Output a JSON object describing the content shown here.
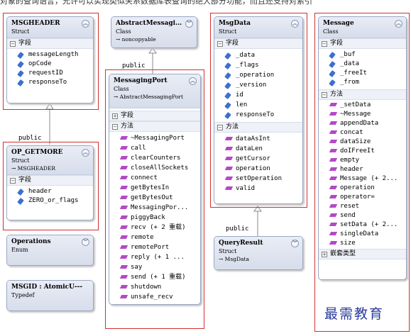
{
  "header_strip": "对象的查询语言，允许可以实现类似关系数据库表查询的绝大部分功能，而且还支持对索引",
  "relation_label": "public",
  "section_labels": {
    "fields": "字段",
    "methods": "方法",
    "nested_types": "嵌套类型"
  },
  "classes": {
    "msgheader": {
      "title": "MSGHEADER",
      "stereotype": "Struct",
      "fields": [
        "messageLength",
        "opCode",
        "requestID",
        "responseTo"
      ]
    },
    "abstract_messaging_port": {
      "title": "AbstractMessagi…",
      "stereotype": "Class",
      "base": "noncopyable"
    },
    "messaging_port": {
      "title": "MessagingPort",
      "stereotype": "Class",
      "base": "AbstractMessagingPort",
      "methods": [
        "~MessagingPort",
        "call",
        "clearCounters",
        "closeAllSockets",
        "connect",
        "getBytesIn",
        "getBytesOut",
        "MessagingPor...",
        "piggyBack",
        "recv (+ 2 重载)",
        "remote",
        "remotePort",
        "reply (+ 1 ...",
        "say",
        "send (+ 1 重载)",
        "shutdown",
        "unsafe_recv"
      ]
    },
    "msgdata": {
      "title": "MsgData",
      "stereotype": "Struct",
      "fields": [
        "_data",
        "_flags",
        "_operation",
        "_version",
        "id",
        "len",
        "responseTo"
      ],
      "methods": [
        "dataAsInt",
        "dataLen",
        "getCursor",
        "operation",
        "setOperation",
        "valid"
      ]
    },
    "message": {
      "title": "Message",
      "stereotype": "Class",
      "fields": [
        "_buf",
        "_data",
        "_freeIt",
        "_from"
      ],
      "methods": [
        "_setData",
        "~Message",
        "appendData",
        "concat",
        "dataSize",
        "doIFreeIt",
        "empty",
        "header",
        "Message (+ 2...",
        "operation",
        "operator=",
        "reset",
        "send",
        "setData (+ 2...",
        "singleData",
        "size"
      ]
    },
    "op_getmore": {
      "title": "OP_GETMORE",
      "stereotype": "Struct",
      "base": "MSGHEADER",
      "fields": [
        "header",
        "ZERO_or_flags"
      ]
    },
    "operations": {
      "title": "Operations",
      "stereotype": "Enum"
    },
    "msgid": {
      "title": "MSGID : AtomicU---",
      "stereotype": "Typedef"
    },
    "query_result": {
      "title": "QueryResult",
      "stereotype": "Struct",
      "base": "MsgData"
    }
  },
  "watermark": "最需教育"
}
